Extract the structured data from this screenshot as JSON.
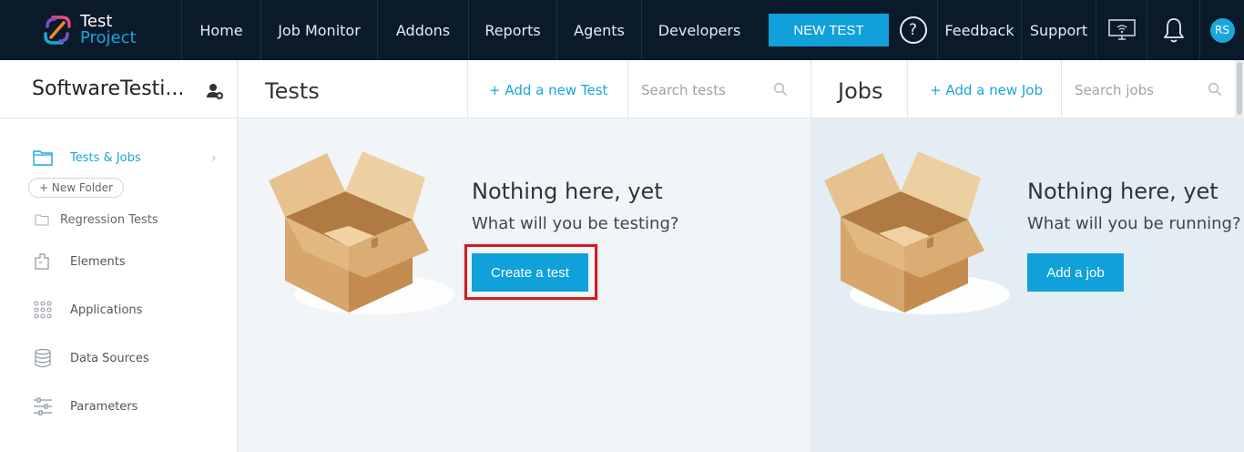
{
  "topbar": {
    "logo_line1": "Test",
    "logo_line2": "Project",
    "nav": {
      "home": "Home",
      "job_monitor": "Job Monitor",
      "addons": "Addons",
      "reports": "Reports",
      "agents": "Agents",
      "developers": "Developers"
    },
    "new_test": "NEW TEST",
    "help_glyph": "?",
    "feedback": "Feedback",
    "support": "Support",
    "avatar_initials": "RS"
  },
  "sidebar": {
    "project_name": "SoftwareTesti...",
    "items": [
      {
        "label": "Tests & Jobs",
        "icon": "folder-icon"
      },
      {
        "label": "Elements",
        "icon": "elements-icon"
      },
      {
        "label": "Applications",
        "icon": "applications-grid-icon"
      },
      {
        "label": "Data Sources",
        "icon": "database-icon"
      },
      {
        "label": "Parameters",
        "icon": "sliders-icon"
      }
    ],
    "new_folder": "+ New Folder",
    "folders": [
      "Regression Tests"
    ]
  },
  "tests": {
    "title": "Tests",
    "add_label": "+  Add a new Test",
    "search_placeholder": "Search tests",
    "empty_title": "Nothing here, yet",
    "empty_sub": "What will you be testing?",
    "cta": "Create a test"
  },
  "jobs": {
    "title": "Jobs",
    "add_label": "+  Add a new Job",
    "search_placeholder": "Search jobs",
    "empty_title": "Nothing here, yet",
    "empty_sub": "What will you be running?",
    "cta": "Add a job"
  },
  "colors": {
    "nav_bg": "#0a1a2a",
    "accent": "#10a0da",
    "highlight_frame": "#d01e26",
    "tests_bg": "#f2f5f8",
    "jobs_bg": "#e5edf4"
  }
}
